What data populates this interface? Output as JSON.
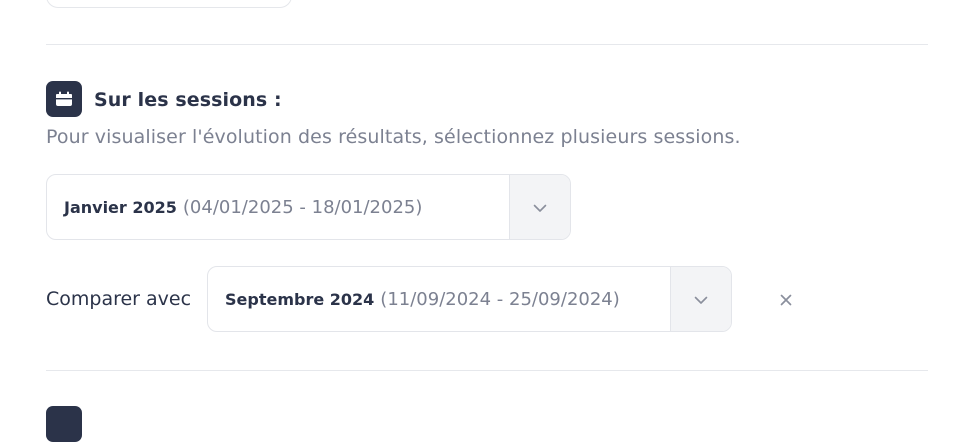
{
  "sessions": {
    "title": "Sur les sessions :",
    "description": "Pour visualiser l'évolution des résultats, sélectionnez plusieurs sessions.",
    "icon": "calendar-icon",
    "primary": {
      "name": "Janvier 2025",
      "range": "(04/01/2025 - 18/01/2025)"
    },
    "compare": {
      "label": "Comparer avec",
      "name": "Septembre 2024",
      "range": "(11/09/2024 - 25/09/2024)"
    }
  },
  "colors": {
    "accent_dark": "#2b3349",
    "muted_text": "#7c8191",
    "border": "#e3e5ea"
  }
}
